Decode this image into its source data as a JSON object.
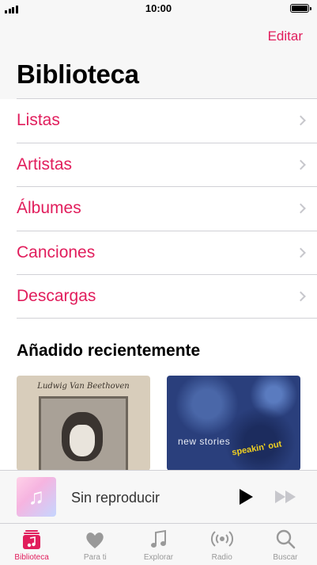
{
  "status_bar": {
    "time": "10:00"
  },
  "header": {
    "edit_label": "Editar",
    "title": "Biblioteca"
  },
  "library_items": [
    {
      "label": "Listas"
    },
    {
      "label": "Artistas"
    },
    {
      "label": "Álbumes"
    },
    {
      "label": "Canciones"
    },
    {
      "label": "Descargas"
    }
  ],
  "recent": {
    "title": "Añadido recientemente",
    "albums": [
      {
        "cover_text": "Ludwig Van Beethoven"
      },
      {
        "cover_text": "new stories",
        "cover_text_2": "speakin' out"
      }
    ]
  },
  "now_playing": {
    "title": "Sin reproducir"
  },
  "tabs": [
    {
      "label": "Biblioteca",
      "icon": "library-icon",
      "active": true
    },
    {
      "label": "Para ti",
      "icon": "heart-icon",
      "active": false
    },
    {
      "label": "Explorar",
      "icon": "music-note-icon",
      "active": false
    },
    {
      "label": "Radio",
      "icon": "radio-icon",
      "active": false
    },
    {
      "label": "Buscar",
      "icon": "search-icon",
      "active": false
    }
  ],
  "colors": {
    "accent": "#e11d5c",
    "inactive": "#999999"
  }
}
